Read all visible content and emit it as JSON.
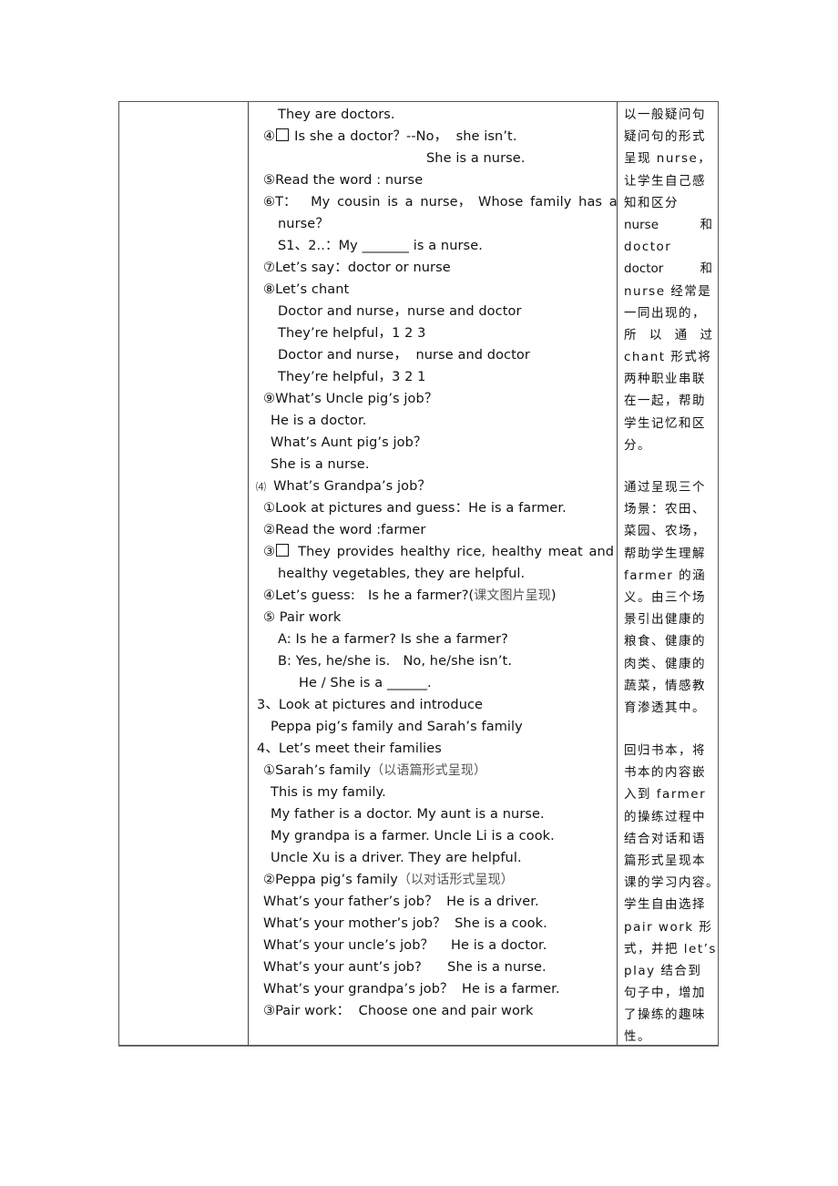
{
  "document": {
    "main_column": {
      "lines": [
        "They are doctors.",
        "④",
        "Is she a doctor？--No，  she isn’t.",
        "She is a nurse.",
        "⑤Read the word : nurse",
        "⑥T：  My cousin is a nurse， Whose family has a",
        "nurse？",
        "S1、2..：My _______ is a nurse.",
        "⑦Let’s say：doctor or nurse",
        "⑧Let’s chant",
        "Doctor and nurse，nurse and doctor",
        "They’re helpful，1 2 3",
        "Doctor and nurse，  nurse and doctor",
        "They’re helpful，3 2 1",
        "⑨What’s Uncle pig’s job？",
        "He is a doctor.",
        "What’s Aunt pig’s job？",
        "She is a nurse.",
        "⑷",
        "What’s Grandpa’s job？",
        "①Look at pictures and guess：He is a farmer.",
        "②Read the word :farmer",
        "③",
        "They provides healthy rice, healthy meat and",
        "healthy vegetables, they are helpful.",
        "④Let’s guess:   Is he a farmer?(",
        "课文图片呈现",
        ")",
        "⑤ Pair work",
        "A: Is he a farmer? Is she a farmer?",
        "B: Yes, he/she is.   No, he/she isn’t.",
        "He / She is a ______.",
        "3、Look at pictures and introduce",
        "Peppa pig’s family and Sarah’s family",
        "4、Let’s meet their families",
        "①Sarah’s family",
        "（以语篇形式呈现）",
        "This is my family.",
        "My father is a doctor. My aunt is a nurse.",
        "My grandpa is a farmer. Uncle Li is a cook.",
        "Uncle Xu is a driver. They are helpful.",
        "②Peppa pig’s family",
        "（以对话形式呈现）",
        "What’s your father’s job？  He is a driver.",
        "What’s your mother’s job？  She is a cook.",
        "What’s your uncle’s job？    He is a doctor.",
        "What’s your aunt’s job?      She is a nurse.",
        "What’s your grandpa’s job？  He is a farmer.",
        "③Pair work：  Choose one and pair work"
      ]
    },
    "side_column": {
      "block1": [
        "以一般疑问句",
        "疑问句的形式",
        "呈现 nurse，",
        "让学生自己感",
        "知和区分",
        [
          "nurse",
          "和"
        ],
        "doctor",
        [
          "doctor",
          "和"
        ],
        "nurse 经常是",
        "一同出现的，",
        [
          "所",
          "以",
          "通",
          "过"
        ],
        "chant 形式将",
        "两种职业串联",
        "在一起，帮助",
        "学生记忆和区",
        "分。"
      ],
      "block2": [
        "通过呈现三个",
        "场景：农田、",
        "菜园、农场，",
        "帮助学生理解",
        "farmer 的涵",
        "义。由三个场",
        "景引出健康的",
        "粮食、健康的",
        "肉类、健康的",
        "蔬菜，情感教",
        "育渗透其中。"
      ],
      "block3": [
        "回归书本，将",
        "书本的内容嵌",
        "入到 farmer",
        "的操练过程中",
        "结合对话和语",
        "篇形式呈现本",
        "课的学习内容。",
        "学生自由选择",
        "pair work 形",
        "式，并把 let’s",
        "play 结合到",
        "句子中，增加",
        "了操练的趣味",
        "性。"
      ]
    }
  }
}
